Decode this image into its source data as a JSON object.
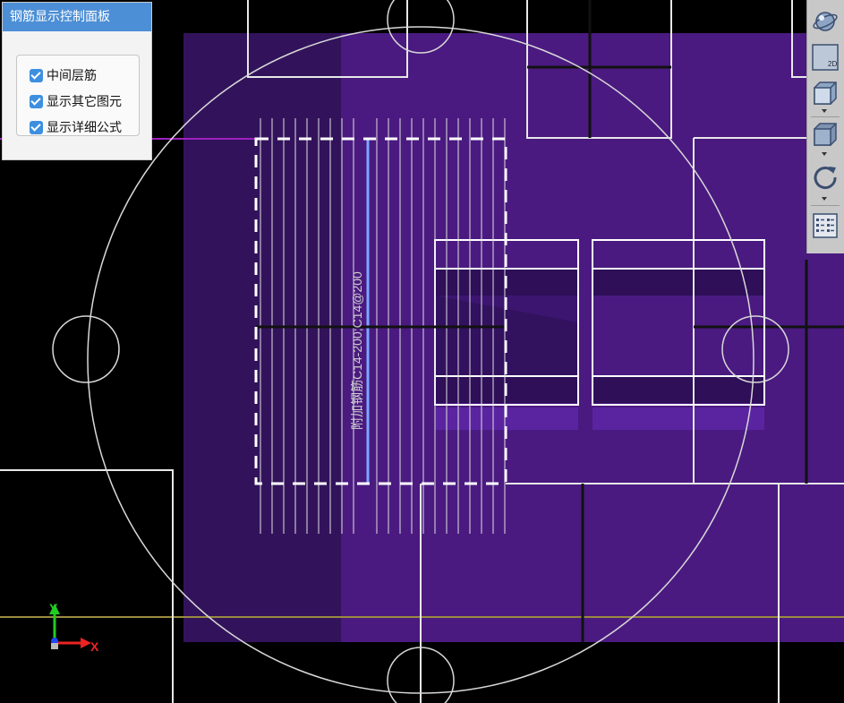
{
  "control_panel": {
    "title": "钢筋显示控制面板",
    "options": [
      {
        "label": "中间层筋",
        "checked": true
      },
      {
        "label": "显示其它图元",
        "checked": true
      },
      {
        "label": "显示详细公式",
        "checked": true
      }
    ]
  },
  "toolbar": {
    "view_2d_label": "2D"
  },
  "canvas": {
    "rebar_annotation": "附加钢筋C14-200;C14@200",
    "axis_x_label": "X",
    "axis_y_label": "Y"
  },
  "colors": {
    "background": "#000000",
    "slab_purple": "#4a1a80",
    "slab_purple_dark": "#3a1668",
    "line_white": "#e8e8e8",
    "selected_rebar": "#7aa8ff",
    "axis_line_yellow": "#9a8a40",
    "magenta_line": "#a020c0",
    "panel_header": "#4d8fd6",
    "checkbox": "#3d8fe0"
  },
  "icons": [
    "orbit-icon",
    "view-2d-icon",
    "box-view-icon",
    "cube-icon",
    "rotate-icon",
    "list-settings-icon"
  ]
}
